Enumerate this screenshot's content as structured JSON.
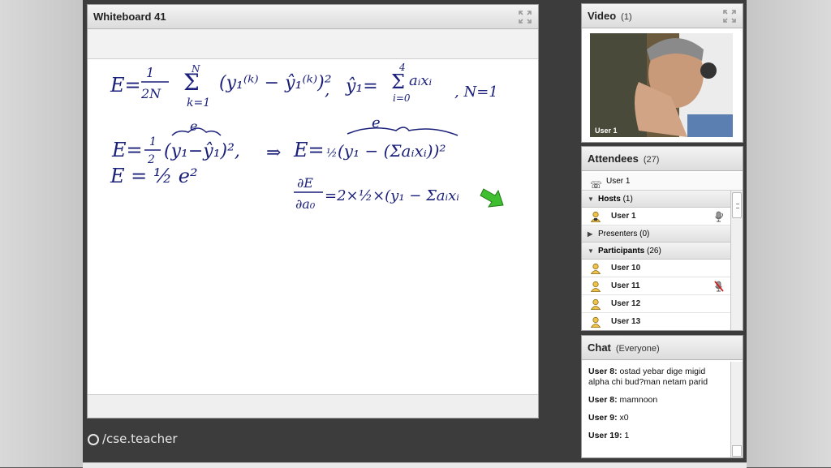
{
  "whiteboard": {
    "title": "Whiteboard 41",
    "ink_color": "#1a1f7a",
    "equations": [
      "E = 1/2N Σ(k=1..N) (y1(k) − ŷ1(k))², ŷ1 = Σ(i=0..4) ai xi , N=1",
      "E = 1/2 (y1 − ŷ1)² ⇒ E = 1/2 (y1 − (Σ ai xi))²",
      "E = 1/2 e²",
      "∂E/∂a0 = 2×1/2 × (y1 − Σ ai xi)"
    ]
  },
  "watermark": "/cse.teacher",
  "video": {
    "title": "Video",
    "count": "(1)",
    "user_label": "User 1"
  },
  "attendees": {
    "title": "Attendees",
    "count": "(27)",
    "me": "User 1",
    "groups": {
      "hosts": {
        "label": "Hosts",
        "count": "(1)",
        "users": [
          "User 1"
        ]
      },
      "presenters": {
        "label": "Presenters",
        "count": "(0)"
      },
      "participants": {
        "label": "Participants",
        "count": "(26)",
        "users": [
          "User 10",
          "User 11",
          "User 12",
          "User 13"
        ]
      }
    }
  },
  "chat": {
    "title": "Chat",
    "scope": "(Everyone)",
    "messages": [
      {
        "sender": "User 8:",
        "text": "ostad yebar dige migid alpha chi bud?man netam parid"
      },
      {
        "sender": "User 8:",
        "text": "mamnoon"
      },
      {
        "sender": "User 9:",
        "text": "x0"
      },
      {
        "sender": "User 19:",
        "text": "1"
      }
    ]
  },
  "icons": {
    "maximize": "maximize-icon",
    "phone": "phone-icon",
    "person": "person-icon",
    "mic": "microphone-icon",
    "mic_muted": "microphone-muted-icon",
    "pointer": "green-arrow-pointer-icon"
  }
}
